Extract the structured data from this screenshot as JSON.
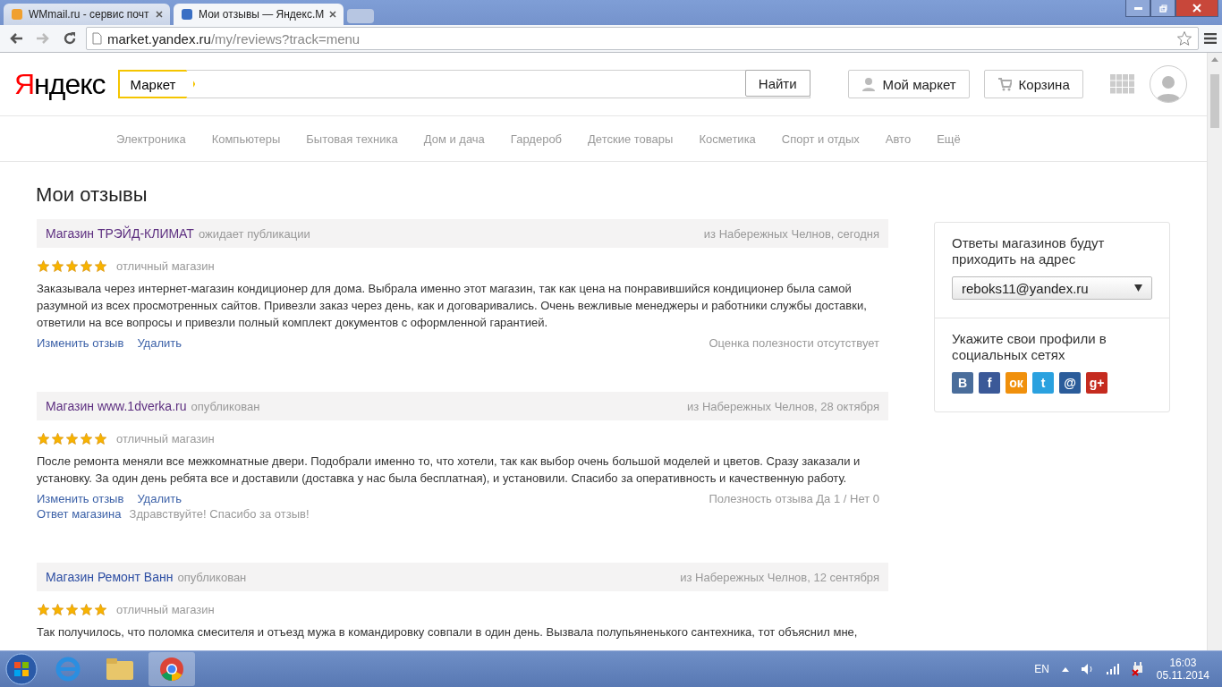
{
  "browser": {
    "tabs": [
      {
        "title": "WMmail.ru - сервис почт",
        "selected": false
      },
      {
        "title": "Мои отзывы — Яндекс.М",
        "selected": true
      }
    ],
    "url_host": "market.yandex.ru",
    "url_path": "/my/reviews?track=menu"
  },
  "header": {
    "logo": "Яндекс",
    "service": "Маркет",
    "search_button": "Найти",
    "my_market": "Мой маркет",
    "cart": "Корзина"
  },
  "nav": [
    "Электроника",
    "Компьютеры",
    "Бытовая техника",
    "Дом и дача",
    "Гардероб",
    "Детские товары",
    "Косметика",
    "Спорт и отдых",
    "Авто",
    "Ещё"
  ],
  "page_title": "Мои отзывы",
  "reviews": [
    {
      "shop": "Магазин ТРЭЙД-КЛИМАТ",
      "visited": true,
      "status": "ожидает публикации",
      "place": "из Набережных Челнов, сегодня",
      "stars": 5,
      "grade": "отличный магазин",
      "text": "Заказывала через интернет-магазин кондиционер для дома. Выбрала именно этот магазин, так как цена на понравившийся кондиционер была самой разумной из всех просмотренных сайтов. Привезли заказ через день, как и договаривались. Очень вежливые менеджеры и работники службы доставки, ответили на все вопросы и привезли полный комплект документов с оформленной гарантией.",
      "actions": [
        "Изменить отзыв",
        "Удалить"
      ],
      "usefulness": "Оценка полезности отсутствует"
    },
    {
      "shop": "Магазин www.1dverka.ru",
      "visited": true,
      "status": "опубликован",
      "place": "из Набережных Челнов, 28 октября",
      "stars": 5,
      "grade": "отличный магазин",
      "text": "После ремонта меняли все межкомнатные двери. Подобрали именно то, что хотели, так как выбор очень большой моделей и цветов. Сразу заказали и установку. За один день ребята все и доставили (доставка у нас была бесплатная), и установили. Спасибо за оперативность и качественную работу.",
      "actions": [
        "Изменить отзыв",
        "Удалить"
      ],
      "usefulness": "Полезность отзыва Да 1 / Нет 0",
      "reply_label": "Ответ магазина",
      "reply": "Здравствуйте! Спасибо за отзыв!"
    },
    {
      "shop": "Магазин Ремонт Ванн",
      "visited": false,
      "status": "опубликован",
      "place": "из Набережных Челнов, 12 сентября",
      "stars": 5,
      "grade": "отличный магазин",
      "text": "Так получилось, что поломка смесителя и отъезд мужа в командировку совпали в один день. Вызвала полупьяненького сантехника, тот объяснил мне,"
    }
  ],
  "sidebar": {
    "reply_note": "Ответы магазинов будут приходить на адрес",
    "email": "reboks11@yandex.ru",
    "social_note": "Укажите свои профили в социальных сетях",
    "social": [
      {
        "label": "В",
        "color": "#4a6d9b"
      },
      {
        "label": "f",
        "color": "#3b5998"
      },
      {
        "label": "ок",
        "color": "#f0900c"
      },
      {
        "label": "t",
        "color": "#2aa1df"
      },
      {
        "label": "@",
        "color": "#2b5c9a"
      },
      {
        "label": "g+",
        "color": "#c52b1f"
      }
    ]
  },
  "taskbar": {
    "lang": "EN",
    "time": "16:03",
    "date": "05.11.2014"
  }
}
